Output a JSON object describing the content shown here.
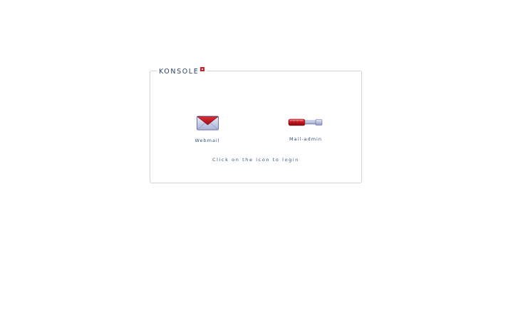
{
  "brand": {
    "name": "KONSOLE",
    "badge_color": "#d31e2a",
    "text_color": "#2c3f66"
  },
  "launchers": [
    {
      "label": "Webmail",
      "icon": "envelope-icon"
    },
    {
      "label": "Mail-admin",
      "icon": "screwdriver-icon"
    }
  ],
  "instruction": "Click on the icon to login",
  "colors": {
    "accent_red": "#d31e2a",
    "label_blue": "#35507c",
    "panel_border": "#d4d4d4"
  }
}
